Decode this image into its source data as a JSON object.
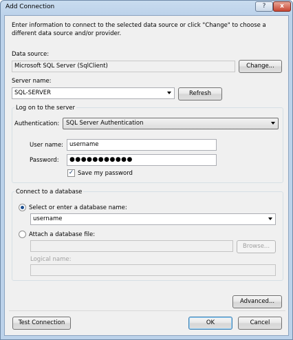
{
  "window": {
    "title": "Add Connection",
    "help_label": "?",
    "close_label": "x"
  },
  "intro_text": "Enter information to connect to the selected data source or click \"Change\" to choose a different data source and/or provider.",
  "data_source": {
    "label": "Data source:",
    "value": "Microsoft SQL Server (SqlClient)",
    "change_button": "Change..."
  },
  "server_name": {
    "label": "Server name:",
    "value": "SQL-SERVER",
    "refresh_button": "Refresh"
  },
  "logon_group": {
    "title": "Log on to the server",
    "authentication_label": "Authentication:",
    "authentication_value": "SQL Server Authentication",
    "username_label": "User name:",
    "username_value": "username",
    "password_label": "Password:",
    "password_value": "●●●●●●●●●●●",
    "save_password_label": "Save my password",
    "save_password_checked": true
  },
  "database_group": {
    "title": "Connect to a database",
    "select_radio_label": "Select or enter a database name:",
    "database_value": "username",
    "attach_radio_label": "Attach a database file:",
    "attach_file_value": "",
    "browse_button": "Browse...",
    "logical_name_label": "Logical name:",
    "logical_name_value": ""
  },
  "footer": {
    "advanced_button": "Advanced...",
    "test_connection_button": "Test Connection",
    "ok_button": "OK",
    "cancel_button": "Cancel"
  }
}
